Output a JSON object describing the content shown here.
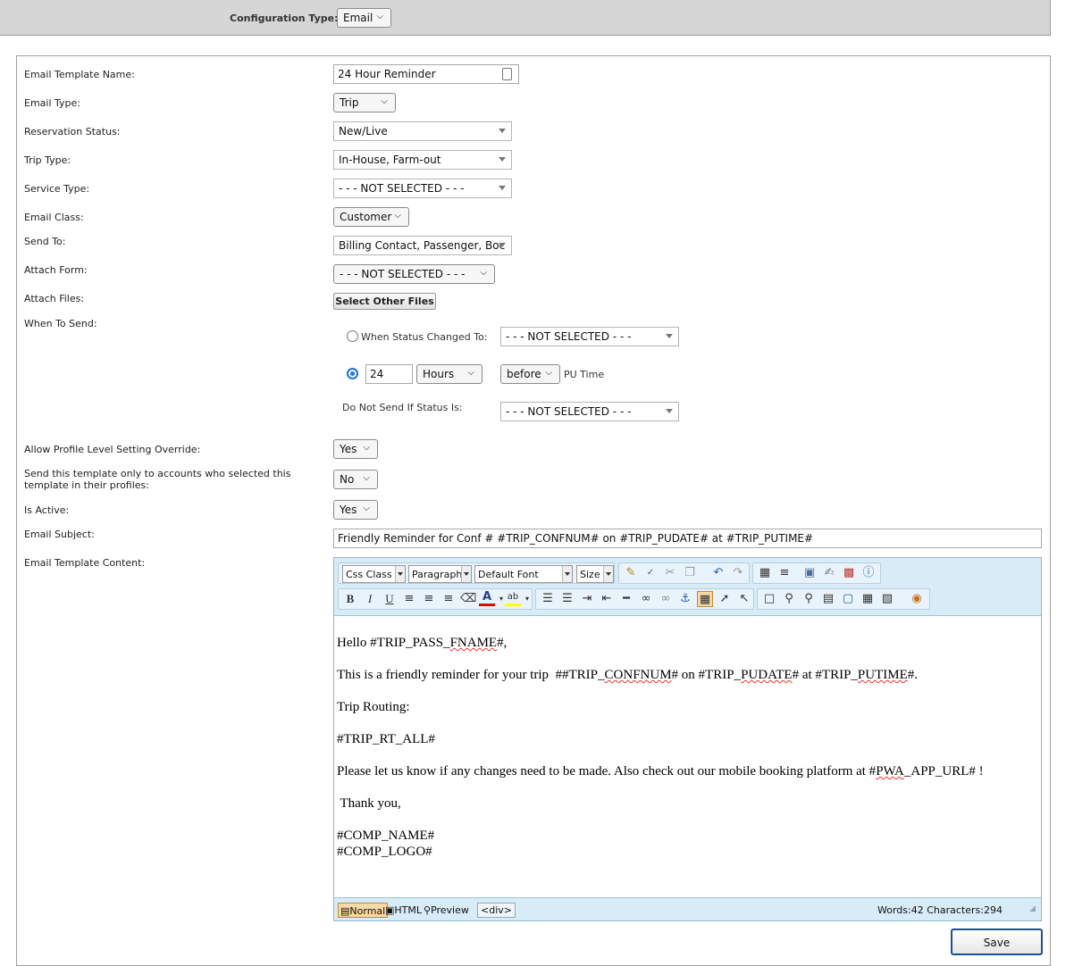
{
  "config": {
    "label": "Configuration Type:",
    "value": "Email"
  },
  "form": {
    "template_name": {
      "label": "Email Template Name:",
      "value": "24 Hour Reminder"
    },
    "email_type": {
      "label": "Email Type:",
      "value": "Trip"
    },
    "reservation_status": {
      "label": "Reservation Status:",
      "value": "New/Live"
    },
    "trip_type": {
      "label": "Trip Type:",
      "value": "In-House, Farm-out"
    },
    "service_type": {
      "label": "Service Type:",
      "value": "- - - NOT SELECTED - - -"
    },
    "email_class": {
      "label": "Email Class:",
      "value": "Customer"
    },
    "send_to": {
      "label": "Send To:",
      "value": "Billing Contact, Passenger, Boc"
    },
    "attach_form": {
      "label": "Attach Form:",
      "value": "- - - NOT SELECTED - - -"
    },
    "attach_files": {
      "label": "Attach Files:",
      "button": "Select Other Files"
    },
    "when_to_send": {
      "label": "When To Send:",
      "status_changed_label": "When Status Changed To:",
      "status_changed_value": "- - - NOT SELECTED - - -",
      "amount": "24",
      "unit": "Hours",
      "relation": "before",
      "reference": "PU Time",
      "do_not_send_label": "Do Not Send If Status Is:",
      "do_not_send_value": "- - - NOT SELECTED - - -"
    },
    "allow_override": {
      "label": "Allow Profile Level Setting Override:",
      "value": "Yes"
    },
    "only_selected": {
      "label": "Send this template only to accounts who selected this template in their profiles:",
      "value": "No"
    },
    "is_active": {
      "label": "Is Active:",
      "value": "Yes"
    },
    "subject": {
      "label": "Email Subject:",
      "value": "Friendly Reminder for Conf # #TRIP_CONFNUM# on #TRIP_PUDATE# at #TRIP_PUTIME#"
    },
    "content_label": "Email Template Content:"
  },
  "editor": {
    "css_class": "Css Class",
    "paragraph": "Paragraph",
    "font": "Default Font",
    "size": "Size",
    "lines": {
      "l1a": "Hello #TRIP_PASS_",
      "l1b": "FNAME",
      "l1c": "#,",
      "l2a": "This is a friendly reminder for your trip  ##TRIP_",
      "l2b": "CONFNUM",
      "l2c": "# on #TRIP_",
      "l2d": "PUDATE",
      "l2e": "# at #TRIP_",
      "l2f": "PUTIME",
      "l2g": "#.",
      "l3": "Trip Routing:",
      "l4": "#TRIP_RT_ALL#",
      "l5a": "Please let us know if any changes need to be made. Also check out our mobile booking platform at #",
      "l5b": "PWA",
      "l5c": "_APP_URL# !",
      "l6": " Thank you,",
      "l7": "#COMP_NAME#",
      "l8": "#COMP_LOGO#"
    },
    "mode_normal": "Normal",
    "mode_html": "HTML",
    "mode_preview": "Preview",
    "tag": "<div>",
    "stats": "Words:42 Characters:294"
  },
  "save_label": "Save"
}
